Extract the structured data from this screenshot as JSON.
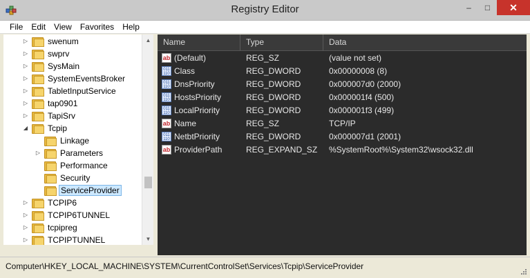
{
  "window": {
    "title": "Registry Editor",
    "minimize": "–",
    "maximize": "□",
    "close": "✕"
  },
  "menu": [
    {
      "label": "File"
    },
    {
      "label": "Edit"
    },
    {
      "label": "View"
    },
    {
      "label": "Favorites"
    },
    {
      "label": "Help"
    }
  ],
  "tree": [
    {
      "label": "swenum",
      "depth": 1,
      "expander": "▷"
    },
    {
      "label": "swprv",
      "depth": 1,
      "expander": "▷"
    },
    {
      "label": "SysMain",
      "depth": 1,
      "expander": "▷"
    },
    {
      "label": "SystemEventsBroker",
      "depth": 1,
      "expander": "▷"
    },
    {
      "label": "TabletInputService",
      "depth": 1,
      "expander": "▷"
    },
    {
      "label": "tap0901",
      "depth": 1,
      "expander": "▷"
    },
    {
      "label": "TapiSrv",
      "depth": 1,
      "expander": "▷"
    },
    {
      "label": "Tcpip",
      "depth": 1,
      "expander": "◢"
    },
    {
      "label": "Linkage",
      "depth": 2,
      "expander": ""
    },
    {
      "label": "Parameters",
      "depth": 2,
      "expander": "▷"
    },
    {
      "label": "Performance",
      "depth": 2,
      "expander": ""
    },
    {
      "label": "Security",
      "depth": 2,
      "expander": ""
    },
    {
      "label": "ServiceProvider",
      "depth": 2,
      "expander": "",
      "selected": true
    },
    {
      "label": "TCPIP6",
      "depth": 1,
      "expander": "▷"
    },
    {
      "label": "TCPIP6TUNNEL",
      "depth": 1,
      "expander": "▷"
    },
    {
      "label": "tcpipreg",
      "depth": 1,
      "expander": "▷"
    },
    {
      "label": "TCPIPTUNNEL",
      "depth": 1,
      "expander": "▷"
    }
  ],
  "columns": {
    "name": "Name",
    "type": "Type",
    "data": "Data"
  },
  "values": [
    {
      "icon": "string-value-icon",
      "name": "(Default)",
      "type": "REG_SZ",
      "data": "(value not set)"
    },
    {
      "icon": "dword-value-icon",
      "name": "Class",
      "type": "REG_DWORD",
      "data": "0x00000008 (8)"
    },
    {
      "icon": "dword-value-icon",
      "name": "DnsPriority",
      "type": "REG_DWORD",
      "data": "0x000007d0 (2000)"
    },
    {
      "icon": "dword-value-icon",
      "name": "HostsPriority",
      "type": "REG_DWORD",
      "data": "0x000001f4 (500)"
    },
    {
      "icon": "dword-value-icon",
      "name": "LocalPriority",
      "type": "REG_DWORD",
      "data": "0x000001f3 (499)"
    },
    {
      "icon": "string-value-icon",
      "name": "Name",
      "type": "REG_SZ",
      "data": "TCP/IP"
    },
    {
      "icon": "dword-value-icon",
      "name": "NetbtPriority",
      "type": "REG_DWORD",
      "data": "0x000007d1 (2001)"
    },
    {
      "icon": "string-value-icon",
      "name": "ProviderPath",
      "type": "REG_EXPAND_SZ",
      "data": "%SystemRoot%\\System32\\wsock32.dll"
    }
  ],
  "status": {
    "path": "Computer\\HKEY_LOCAL_MACHINE\\SYSTEM\\CurrentControlSet\\Services\\Tcpip\\ServiceProvider"
  },
  "icons": {
    "string_glyph": "ab",
    "dword_glyph": "011 110"
  },
  "colors": {
    "list_bg": "#2b2b2b",
    "selection": "#cce8ff",
    "close_button": "#c7332b"
  }
}
